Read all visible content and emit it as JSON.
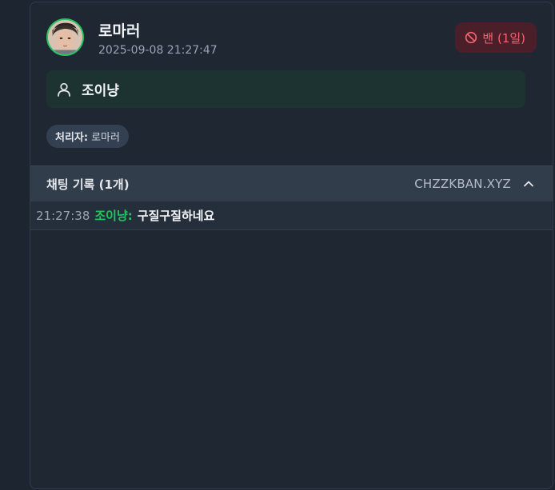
{
  "card": {
    "moderator_name": "로마러",
    "timestamp": "2025-09-08 21:27:47",
    "ban_badge": {
      "label": "밴 (1일)",
      "icon": "ban-icon",
      "color": "#f0646e"
    },
    "target": {
      "icon": "user-icon",
      "name": "조이냥"
    },
    "handler": {
      "label": "처리자:",
      "value": "로마러"
    },
    "avatar": {
      "icon": "avatar-photo",
      "ring_color": "#22c55e"
    }
  },
  "chat_log": {
    "title": "채팅 기록 (1개)",
    "site": "CHZZKBAN.XYZ",
    "toggle_icon": "chevron-up-icon",
    "messages": [
      {
        "time": "21:27:38",
        "user": "조이냥:",
        "text": "구질구질하네요"
      }
    ]
  }
}
